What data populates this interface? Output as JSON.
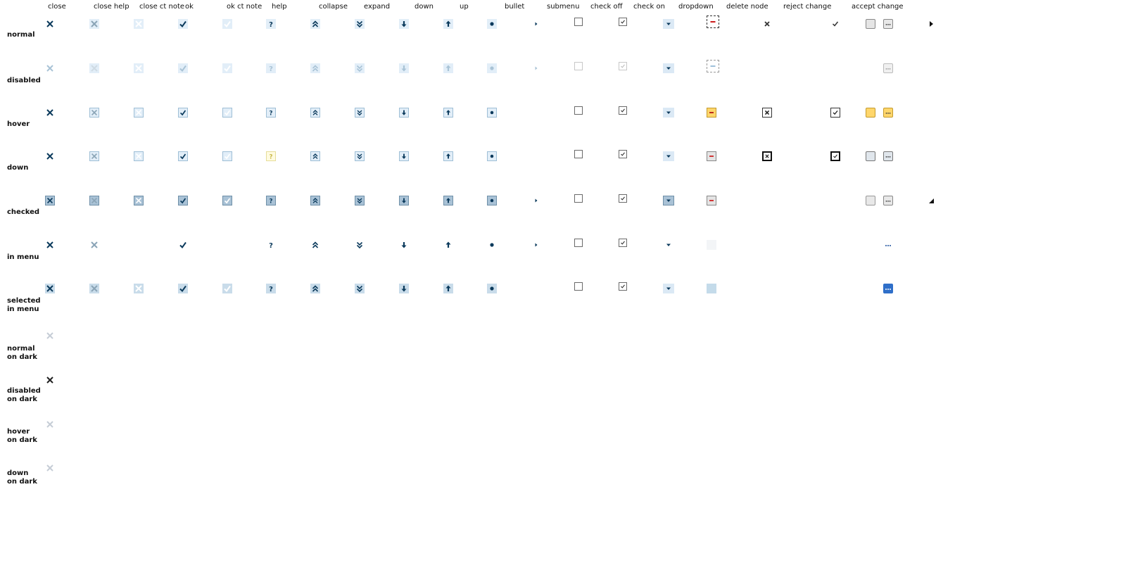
{
  "columns": [
    {
      "id": "close",
      "label": "close"
    },
    {
      "id": "close-help",
      "label": "close help"
    },
    {
      "id": "close-ct-note",
      "label": "close ct note"
    },
    {
      "id": "ok",
      "label": "ok"
    },
    {
      "id": "ok-ct-note",
      "label": "ok ct note"
    },
    {
      "id": "help",
      "label": "help"
    },
    {
      "id": "collapse",
      "label": "collapse"
    },
    {
      "id": "expand",
      "label": "expand"
    },
    {
      "id": "down",
      "label": "down"
    },
    {
      "id": "up",
      "label": "up"
    },
    {
      "id": "bullet",
      "label": "bullet"
    },
    {
      "id": "submenu",
      "label": "submenu"
    },
    {
      "id": "check-off",
      "label": "check off"
    },
    {
      "id": "check-on",
      "label": "check on"
    },
    {
      "id": "dropdown",
      "label": "dropdown"
    },
    {
      "id": "delete-node",
      "label": "delete node"
    },
    {
      "id": "reject-change",
      "label": "reject change"
    },
    {
      "id": "accept-change",
      "label": "accept change"
    }
  ],
  "rows": [
    {
      "id": "normal",
      "label": "normal"
    },
    {
      "id": "disabled",
      "label": "disabled"
    },
    {
      "id": "hover",
      "label": "hover"
    },
    {
      "id": "down",
      "label": "down"
    },
    {
      "id": "checked",
      "label": "checked"
    },
    {
      "id": "in-menu",
      "label": "in menu"
    },
    {
      "id": "selected-in-menu",
      "label": "selected\nin menu"
    },
    {
      "id": "normal-on-dark",
      "label": "normal\non dark"
    },
    {
      "id": "disabled-on-dark",
      "label": "disabled\non dark"
    },
    {
      "id": "hover-on-dark",
      "label": "hover\non dark"
    },
    {
      "id": "down-on-dark",
      "label": "down\non dark"
    }
  ],
  "glyphs": {
    "close": "×",
    "help": "?",
    "bullet": "●",
    "more": "..."
  },
  "colors": {
    "icon_dark": "#0b3a5c",
    "icon_disabled": "#a9c3d6",
    "box_normal": "#d8e8f4",
    "box_checked": "#8fb0c8",
    "hover_orange_bg": "#ffd66b",
    "delete_red": "#cc1b1b",
    "selected_blue": "#2f6fc9",
    "help_down_bg": "#fffbe0"
  }
}
